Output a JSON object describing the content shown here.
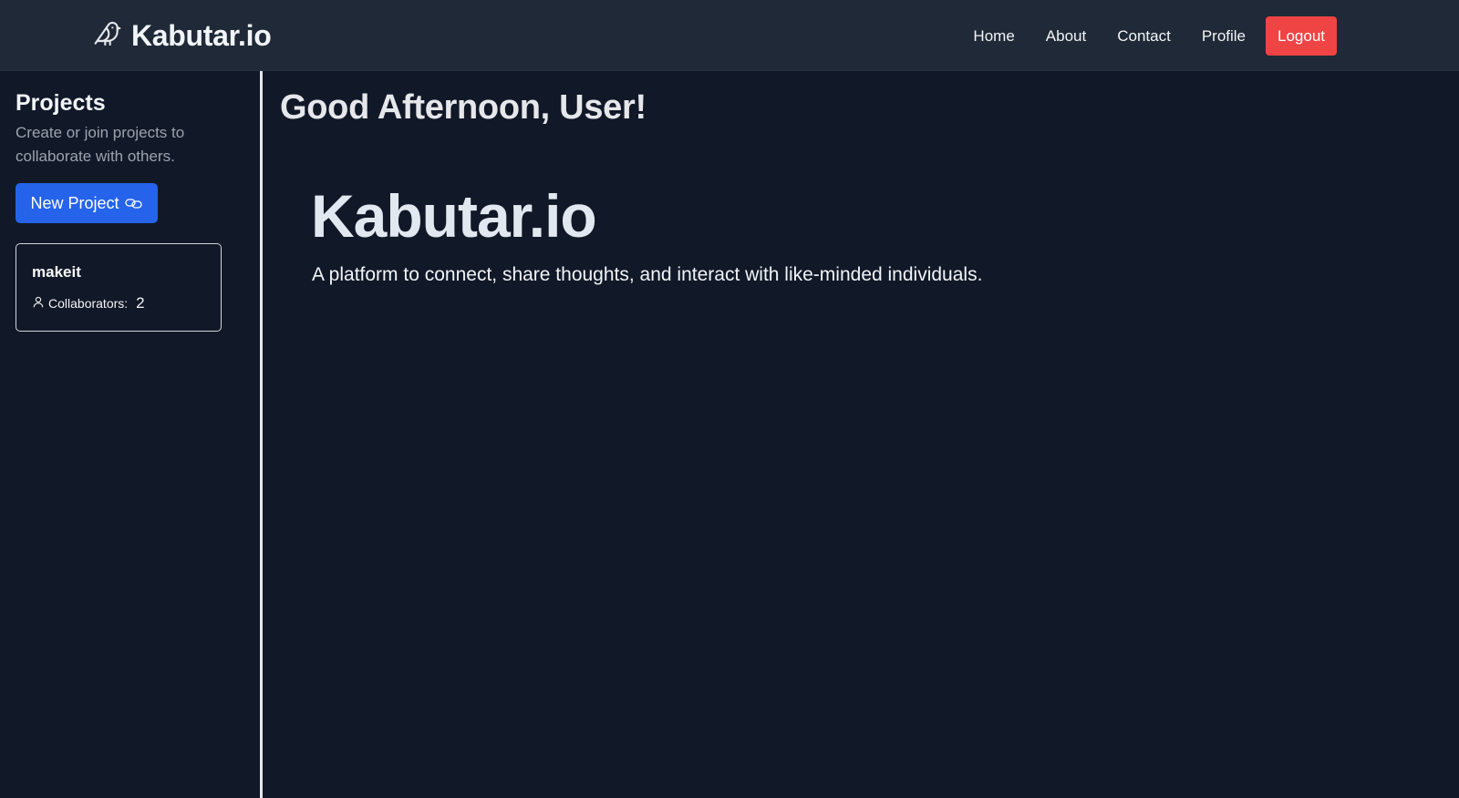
{
  "navbar": {
    "brand": "Kabutar.io",
    "links": [
      "Home",
      "About",
      "Contact",
      "Profile"
    ],
    "logout_label": "Logout"
  },
  "sidebar": {
    "title": "Projects",
    "subtitle": "Create or join projects to collaborate with others.",
    "new_project_label": "New Project",
    "projects": [
      {
        "name": "makeit",
        "collaborators_label": "Collaborators:",
        "collaborators_count": "2"
      }
    ]
  },
  "main": {
    "greeting": "Good Afternoon, User!",
    "hero_title": "Kabutar.io",
    "hero_subtitle": "A platform to connect, share thoughts, and interact with like-minded individuals."
  },
  "colors": {
    "page_bg": "#111827",
    "navbar_bg": "#1f2937",
    "primary": "#2563eb",
    "danger": "#ef4444"
  },
  "icons": {
    "brand": "bird-icon",
    "new_project": "link-icon",
    "collaborators": "user-icon"
  }
}
